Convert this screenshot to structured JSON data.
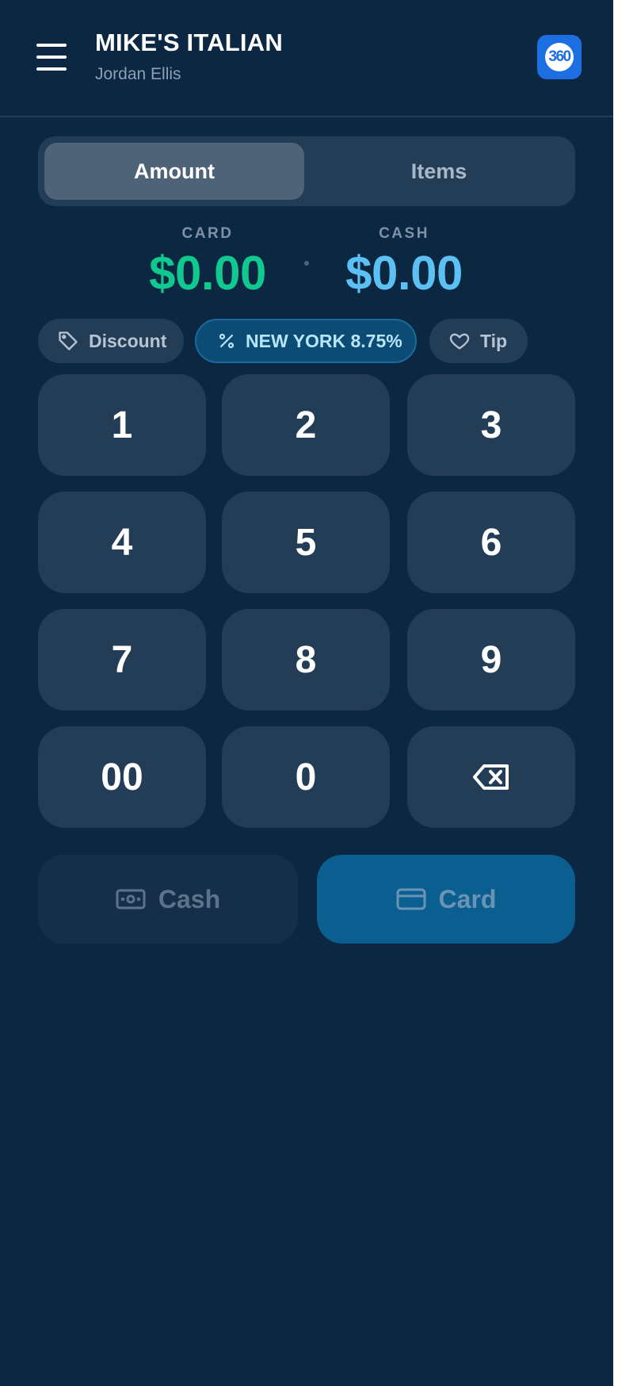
{
  "header": {
    "business_name": "MIKE'S ITALIAN",
    "user_name": "Jordan Ellis",
    "logo_text": "360",
    "menu_icon": "hamburger-menu-icon"
  },
  "mode_tabs": [
    {
      "label": "Amount",
      "active": true
    },
    {
      "label": "Items",
      "active": false
    }
  ],
  "totals": {
    "card": {
      "label": "CARD",
      "value": "$0.00",
      "color": "#0fc98e"
    },
    "cash": {
      "label": "CASH",
      "value": "$0.00",
      "color": "#5cc1f2"
    }
  },
  "chips": {
    "discount": {
      "label": "Discount",
      "icon": "tag-icon"
    },
    "tax": {
      "label": "NEW YORK 8.75%",
      "icon": "percent-icon"
    },
    "tip": {
      "label": "Tip",
      "icon": "heart-icon"
    }
  },
  "keypad": [
    "1",
    "2",
    "3",
    "4",
    "5",
    "6",
    "7",
    "8",
    "9",
    "00",
    "0"
  ],
  "keypad_backspace_icon": "backspace-icon",
  "payment": {
    "cash": {
      "label": "Cash",
      "icon": "cash-icon"
    },
    "card": {
      "label": "Card",
      "icon": "credit-card-icon"
    }
  },
  "colors": {
    "background": "#0b2742",
    "surface": "#243d57",
    "card_accent": "#0fc98e",
    "cash_accent": "#5cc1f2",
    "primary_button": "#0a5f90"
  }
}
